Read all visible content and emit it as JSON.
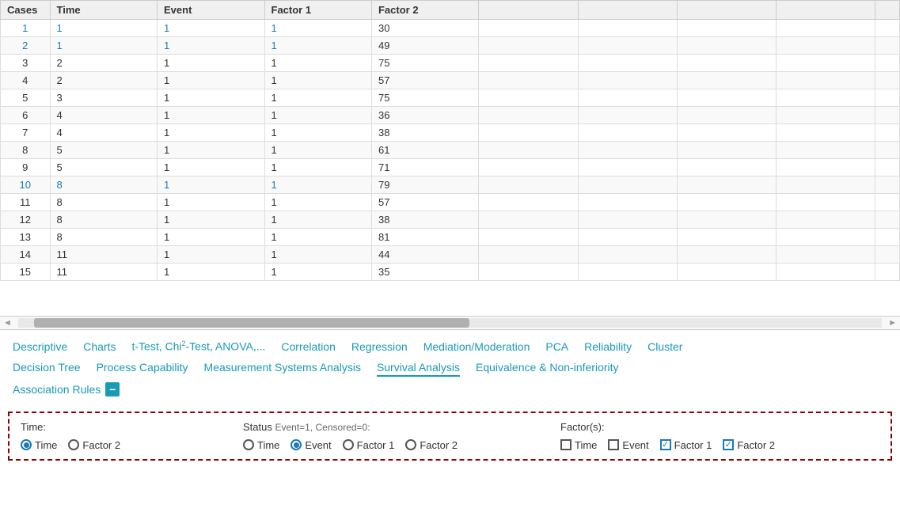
{
  "table": {
    "columns": [
      "Cases",
      "Time",
      "Event",
      "Factor 1",
      "Factor 2",
      "",
      "",
      "",
      "",
      ""
    ],
    "rows": [
      {
        "cases": "1",
        "time": "1",
        "event": "1",
        "factor1": "1",
        "factor2": "30",
        "isLink": true
      },
      {
        "cases": "2",
        "time": "1",
        "event": "1",
        "factor1": "1",
        "factor2": "49",
        "isLink": true
      },
      {
        "cases": "3",
        "time": "2",
        "event": "1",
        "factor1": "1",
        "factor2": "75",
        "isLink": false
      },
      {
        "cases": "4",
        "time": "2",
        "event": "1",
        "factor1": "1",
        "factor2": "57",
        "isLink": false
      },
      {
        "cases": "5",
        "time": "3",
        "event": "1",
        "factor1": "1",
        "factor2": "75",
        "isLink": false
      },
      {
        "cases": "6",
        "time": "4",
        "event": "1",
        "factor1": "1",
        "factor2": "36",
        "isLink": false
      },
      {
        "cases": "7",
        "time": "4",
        "event": "1",
        "factor1": "1",
        "factor2": "38",
        "isLink": false
      },
      {
        "cases": "8",
        "time": "5",
        "event": "1",
        "factor1": "1",
        "factor2": "61",
        "isLink": false
      },
      {
        "cases": "9",
        "time": "5",
        "event": "1",
        "factor1": "1",
        "factor2": "71",
        "isLink": false
      },
      {
        "cases": "10",
        "time": "8",
        "event": "1",
        "factor1": "1",
        "factor2": "79",
        "isLink": true
      },
      {
        "cases": "11",
        "time": "8",
        "event": "1",
        "factor1": "1",
        "factor2": "57",
        "isLink": false
      },
      {
        "cases": "12",
        "time": "8",
        "event": "1",
        "factor1": "1",
        "factor2": "38",
        "isLink": false
      },
      {
        "cases": "13",
        "time": "8",
        "event": "1",
        "factor1": "1",
        "factor2": "81",
        "isLink": false
      },
      {
        "cases": "14",
        "time": "11",
        "event": "1",
        "factor1": "1",
        "factor2": "44",
        "isLink": false
      },
      {
        "cases": "15",
        "time": "11",
        "event": "1",
        "factor1": "1",
        "factor2": "35",
        "isLink": false
      }
    ]
  },
  "nav": {
    "items": [
      {
        "label": "Descriptive",
        "active": false
      },
      {
        "label": "Charts",
        "active": false
      },
      {
        "label": "t-Test, Chi²-Test, ANOVA,...",
        "active": false
      },
      {
        "label": "Correlation",
        "active": false
      },
      {
        "label": "Regression",
        "active": false
      },
      {
        "label": "Mediation/Moderation",
        "active": false
      },
      {
        "label": "PCA",
        "active": false
      },
      {
        "label": "Reliability",
        "active": false
      },
      {
        "label": "Cluster",
        "active": false
      }
    ],
    "items2": [
      {
        "label": "Decision Tree",
        "active": false
      },
      {
        "label": "Process Capability",
        "active": false
      },
      {
        "label": "Measurement Systems Analysis",
        "active": false
      },
      {
        "label": "Survival Analysis",
        "active": true
      },
      {
        "label": "Equivalence & Non-inferiority",
        "active": false
      }
    ],
    "items3": [
      {
        "label": "Association Rules",
        "active": false
      }
    ],
    "minus_label": "−"
  },
  "bottom": {
    "time_label": "Time:",
    "time_options": [
      {
        "label": "Time",
        "checked": true
      },
      {
        "label": "Factor 2",
        "checked": false
      }
    ],
    "status_label": "Status",
    "status_info": "Event=1, Censored=0:",
    "status_options": [
      {
        "label": "Time",
        "checked": false
      },
      {
        "label": "Event",
        "checked": true
      },
      {
        "label": "Factor 1",
        "checked": false
      },
      {
        "label": "Factor 2",
        "checked": false
      }
    ],
    "factors_label": "Factor(s):",
    "factor_options": [
      {
        "label": "Time",
        "checked": false
      },
      {
        "label": "Event",
        "checked": false
      },
      {
        "label": "Factor 1",
        "checked": true
      },
      {
        "label": "Factor 2",
        "checked": true
      }
    ]
  }
}
